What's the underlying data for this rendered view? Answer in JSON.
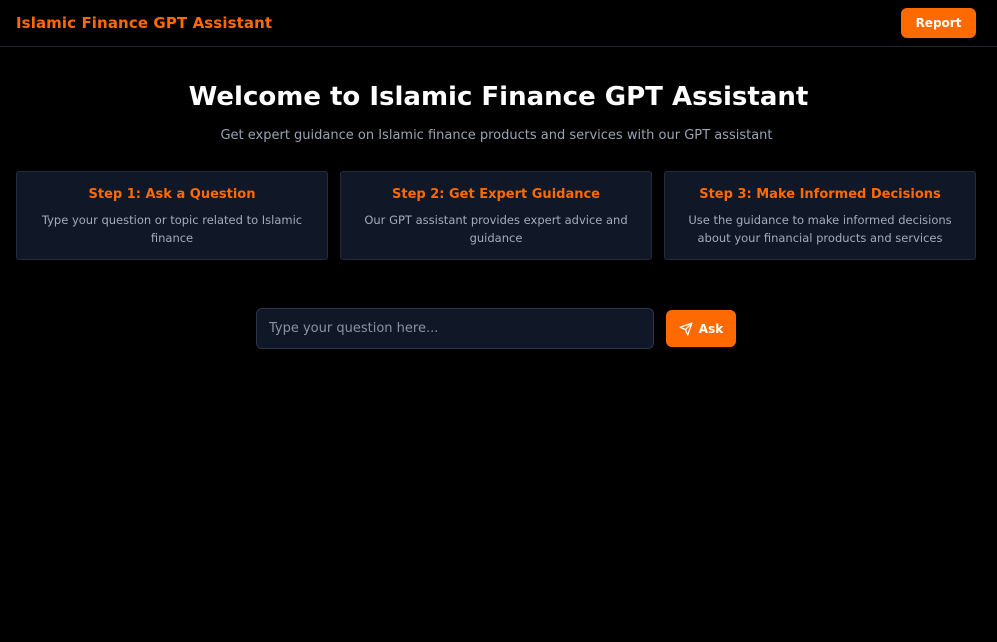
{
  "header": {
    "brand": "Islamic Finance GPT Assistant",
    "report_label": "Report"
  },
  "hero": {
    "title": "Welcome to Islamic Finance GPT Assistant",
    "subtitle": "Get expert guidance on Islamic finance products and services with our GPT assistant"
  },
  "steps": [
    {
      "title": "Step 1: Ask a Question",
      "description": "Type your question or topic related to Islamic finance"
    },
    {
      "title": "Step 2: Get Expert Guidance",
      "description": "Our GPT assistant provides expert advice and guidance"
    },
    {
      "title": "Step 3: Make Informed Decisions",
      "description": "Use the guidance to make informed decisions about your financial products and services"
    }
  ],
  "ask": {
    "placeholder": "Type your question here...",
    "value": "",
    "button_label": "Ask",
    "button_icon": "send-icon"
  },
  "colors": {
    "accent": "#ff6a00",
    "background": "#000000",
    "card_background": "#101726"
  }
}
